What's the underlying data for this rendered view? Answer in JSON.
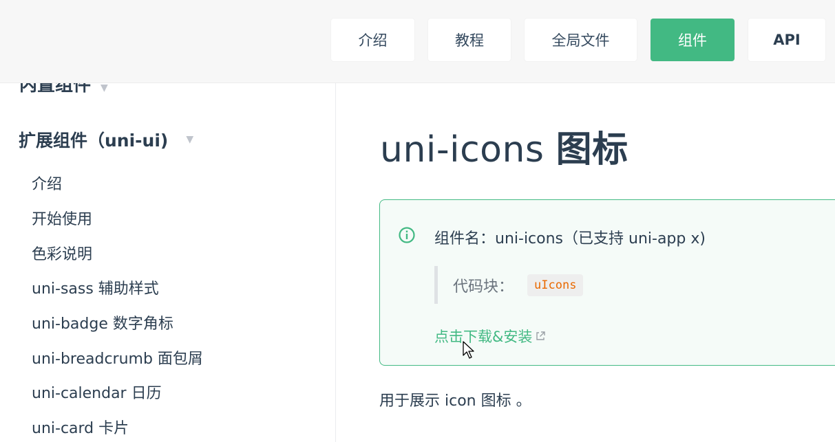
{
  "header": {
    "nav": [
      "介绍",
      "教程",
      "全局文件",
      "组件",
      "API"
    ],
    "active_index": 3
  },
  "sidebar": {
    "partial_group_label": "内置组件",
    "group_label": "扩展组件（uni-ui)",
    "items": [
      "介绍",
      "开始使用",
      "色彩说明",
      "uni-sass 辅助样式",
      "uni-badge 数字角标",
      "uni-breadcrumb 面包屑",
      "uni-calendar 日历",
      "uni-card 卡片"
    ]
  },
  "main": {
    "title_latin": "uni-icons ",
    "title_cjk": "图标",
    "tip": {
      "component_label": "组件名：uni-icons（已支持 uni-app x)",
      "code_label": "代码块：",
      "code_value": "uIcons",
      "download_link": "点击下载&安装"
    },
    "description": "用于展示 icon 图标 。"
  },
  "colors": {
    "accent": "#42b983",
    "code": "#e96900",
    "text": "#2c3e50"
  }
}
